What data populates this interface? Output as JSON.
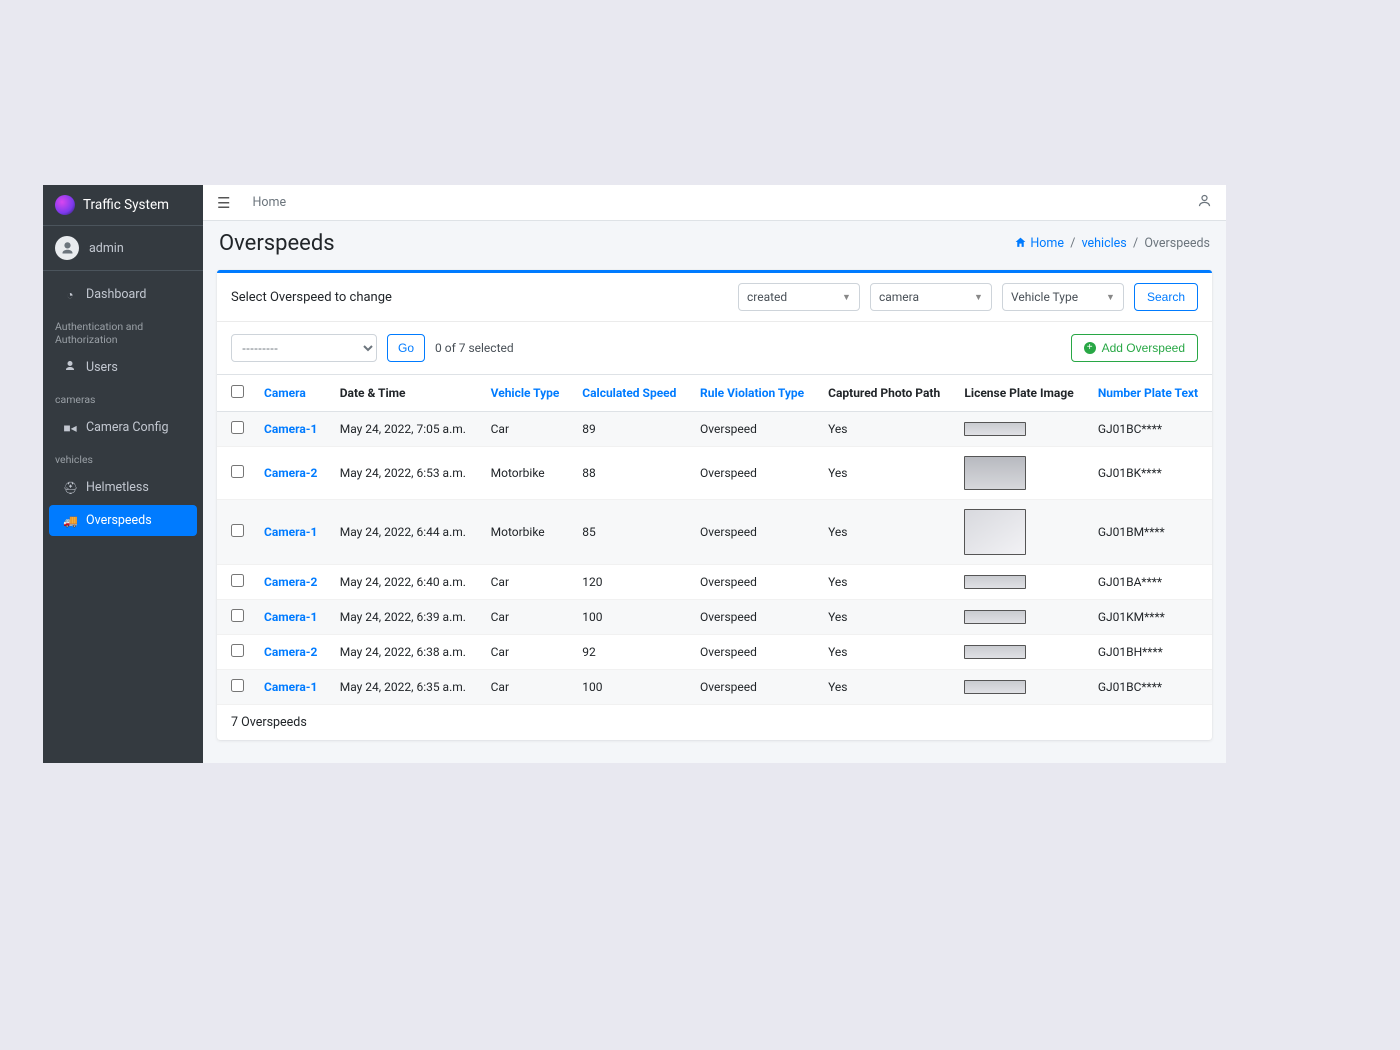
{
  "brand": "Traffic System",
  "user": "admin",
  "sidebar": {
    "items": [
      {
        "label": "Dashboard",
        "icon": "dashboard-icon"
      }
    ],
    "groups": [
      {
        "heading": "Authentication and Authorization",
        "items": [
          {
            "label": "Users",
            "icon": "user-icon"
          }
        ]
      },
      {
        "heading": "cameras",
        "items": [
          {
            "label": "Camera Config",
            "icon": "camera-icon"
          }
        ]
      },
      {
        "heading": "vehicles",
        "items": [
          {
            "label": "Helmetless",
            "icon": "helmet-icon"
          },
          {
            "label": "Overspeeds",
            "icon": "truck-icon",
            "active": true
          }
        ]
      }
    ]
  },
  "topbar": {
    "home": "Home"
  },
  "page": {
    "title": "Overspeeds",
    "breadcrumb": {
      "home": "Home",
      "group": "vehicles",
      "current": "Overspeeds"
    },
    "card_title": "Select Overspeed to change",
    "filters": {
      "created": "created",
      "camera": "camera",
      "vehicle_type": "Vehicle Type"
    },
    "search": "Search",
    "action_placeholder": "---------",
    "go": "Go",
    "selection_count": "0 of 7 selected",
    "add_label": "Add Overspeed",
    "columns": {
      "camera": "Camera",
      "date": "Date & Time",
      "vtype": "Vehicle Type",
      "speed": "Calculated Speed",
      "rule": "Rule Violation Type",
      "photo": "Captured Photo Path",
      "plate_img": "License Plate Image",
      "plate_txt": "Number Plate Text"
    },
    "rows": [
      {
        "camera": "Camera-1",
        "date": "May 24, 2022, 7:05 a.m.",
        "vtype": "Car",
        "speed": "89",
        "rule": "Overspeed",
        "photo": "Yes",
        "plate_txt": "GJ01BC****",
        "img": "short"
      },
      {
        "camera": "Camera-2",
        "date": "May 24, 2022, 6:53 a.m.",
        "vtype": "Motorbike",
        "speed": "88",
        "rule": "Overspeed",
        "photo": "Yes",
        "plate_txt": "GJ01BK****",
        "img": "tall"
      },
      {
        "camera": "Camera-1",
        "date": "May 24, 2022, 6:44 a.m.",
        "vtype": "Motorbike",
        "speed": "85",
        "rule": "Overspeed",
        "photo": "Yes",
        "plate_txt": "GJ01BM****",
        "img": "taller"
      },
      {
        "camera": "Camera-2",
        "date": "May 24, 2022, 6:40 a.m.",
        "vtype": "Car",
        "speed": "120",
        "rule": "Overspeed",
        "photo": "Yes",
        "plate_txt": "GJ01BA****",
        "img": "short"
      },
      {
        "camera": "Camera-1",
        "date": "May 24, 2022, 6:39 a.m.",
        "vtype": "Car",
        "speed": "100",
        "rule": "Overspeed",
        "photo": "Yes",
        "plate_txt": "GJ01KM****",
        "img": "short"
      },
      {
        "camera": "Camera-2",
        "date": "May 24, 2022, 6:38 a.m.",
        "vtype": "Car",
        "speed": "92",
        "rule": "Overspeed",
        "photo": "Yes",
        "plate_txt": "GJ01BH****",
        "img": "short"
      },
      {
        "camera": "Camera-1",
        "date": "May 24, 2022, 6:35 a.m.",
        "vtype": "Car",
        "speed": "100",
        "rule": "Overspeed",
        "photo": "Yes",
        "plate_txt": "GJ01BC****",
        "img": "short"
      }
    ],
    "footer": "7 Overspeeds"
  }
}
